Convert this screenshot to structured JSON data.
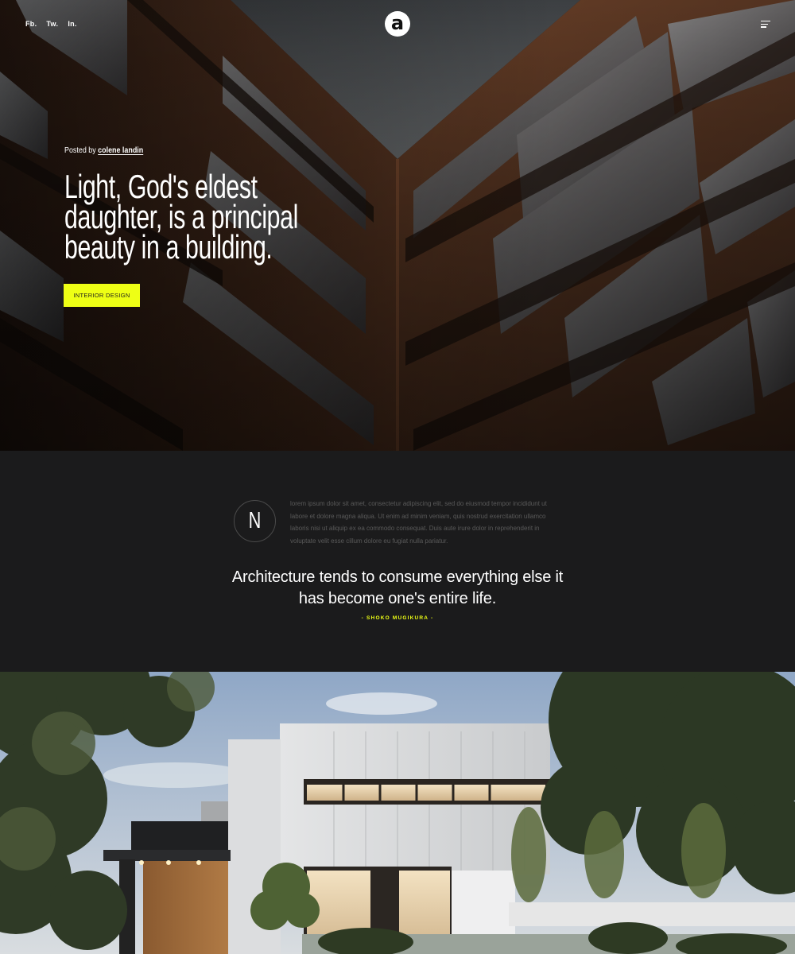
{
  "header": {
    "social": [
      "Fb.",
      "Tw.",
      "In."
    ],
    "logo_letter": "a"
  },
  "hero": {
    "posted_prefix": "Posted by",
    "author": "colene landin",
    "title": "Light, God's eldest daughter, is a principal beauty in a building.",
    "tag": "Interior Design"
  },
  "intro": {
    "dropcap": "N",
    "paragraph": "lorem ipsum dolor sit amet, consectetur adipiscing elit, sed do eiusmod tempor incididunt ut labore et dolore magna aliqua. Ut enim ad minim veniam, quis nostrud exercitation ullamco laboris nisi ut aliquip ex ea commodo consequat. Duis aute irure dolor in reprehenderit in voluptate velit esse cillum dolore eu fugiat nulla pariatur."
  },
  "quote": {
    "text": "Architecture tends to consume everything else it has become one's entire life.",
    "author": "- SHOKO MUGIKURA -"
  },
  "colors": {
    "accent": "#eeff15",
    "dark_bg": "#1b1b1c"
  },
  "icons": [
    "menu-icon",
    "logo-icon"
  ]
}
